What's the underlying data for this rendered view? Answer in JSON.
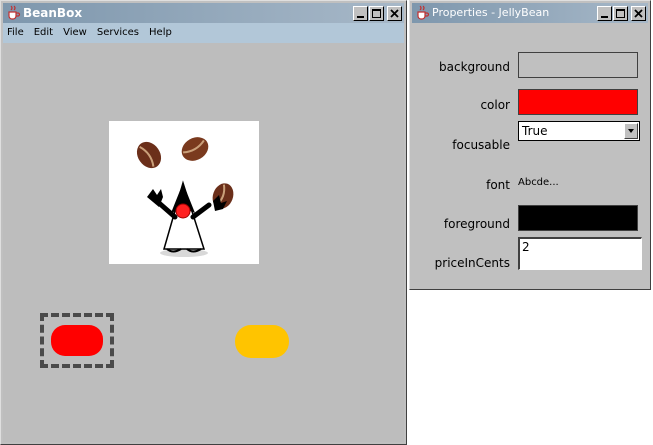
{
  "beanbox": {
    "title": "BeanBox",
    "menu": [
      "File",
      "Edit",
      "View",
      "Services",
      "Help"
    ]
  },
  "properties": {
    "title": "Properties - JellyBean",
    "labels": {
      "background": "background",
      "color": "color",
      "focusable": "focusable",
      "font": "font",
      "foreground": "foreground",
      "price": "priceInCents"
    },
    "values": {
      "focusable": "True",
      "font": "Abcde...",
      "price": "2"
    }
  },
  "colors": {
    "titlebar": "#8aa2b8",
    "menubar": "#b2c7d8",
    "canvas": "#bdbdbd",
    "background_swatch": "#c0c0c0",
    "color_swatch": "#ff0000",
    "foreground_swatch": "#000000",
    "selected_bean": "#ff0000",
    "other_bean": "#ffc400"
  },
  "icons": {
    "window_icon": "java-cup-icon",
    "minimize": "minimize-icon",
    "maximize": "maximize-icon",
    "close": "close-icon",
    "dropdown": "chevron-down-icon"
  }
}
